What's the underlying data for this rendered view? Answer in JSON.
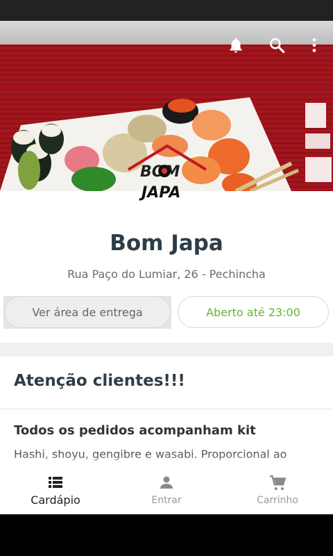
{
  "restaurant": {
    "name": "Bom Japa",
    "address": "Rua Paço do Lumiar, 26 - Pechincha",
    "delivery_button": "Ver área de entrega",
    "hours_badge": "Aberto até 23:00",
    "logo_text_top": "BOM",
    "logo_text_bottom": "JAPA"
  },
  "notice": {
    "title": "Atenção clientes!!!",
    "item_title": "Todos os pedidos acompanham kit",
    "item_desc": "Hashi, shoyu, gengibre e wasabi. Proporcional ao"
  },
  "bottom_nav": {
    "items": [
      {
        "label": "Cardápio",
        "icon": "menu-list-icon",
        "active": true
      },
      {
        "label": "Entrar",
        "icon": "person-icon",
        "active": false
      },
      {
        "label": "Carrinho",
        "icon": "cart-icon",
        "active": false
      }
    ]
  },
  "colors": {
    "banner_red": "#a3151d",
    "open_green": "#62b632",
    "title_dark": "#2e3d48"
  }
}
